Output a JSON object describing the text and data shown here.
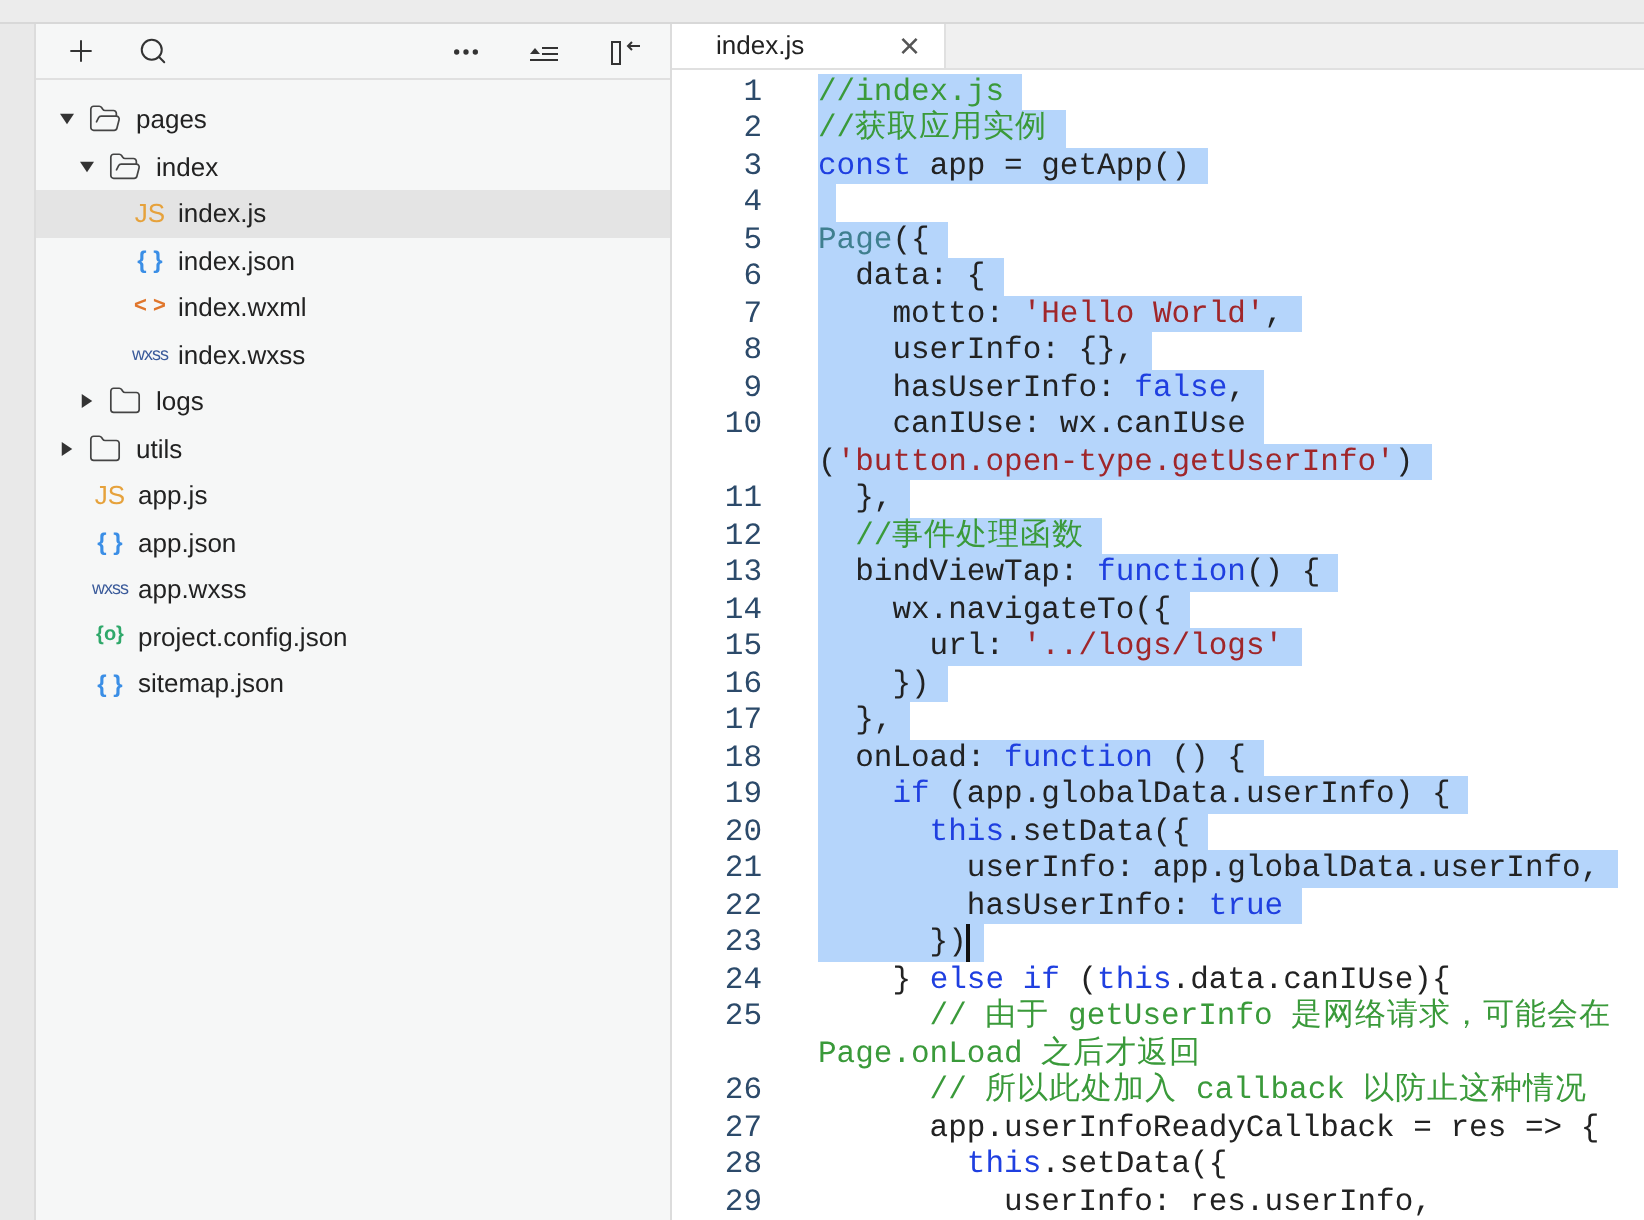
{
  "sidebar": {
    "tree": [
      {
        "name": "pages",
        "kind": "folder",
        "expanded": true,
        "selected": false,
        "children": [
          {
            "name": "index",
            "kind": "folder",
            "expanded": true,
            "selected": false,
            "children": [
              {
                "name": "index.js",
                "kind": "js",
                "icon": "JS",
                "selected": true
              },
              {
                "name": "index.json",
                "kind": "json",
                "icon": "{ }",
                "selected": false
              },
              {
                "name": "index.wxml",
                "kind": "wxml",
                "icon": "< >",
                "selected": false
              },
              {
                "name": "index.wxss",
                "kind": "wxss",
                "icon": "wxss",
                "selected": false
              }
            ]
          },
          {
            "name": "logs",
            "kind": "folder",
            "expanded": false,
            "selected": false
          }
        ]
      },
      {
        "name": "utils",
        "kind": "folder",
        "expanded": false,
        "selected": false
      },
      {
        "name": "app.js",
        "kind": "js",
        "icon": "JS",
        "selected": false
      },
      {
        "name": "app.json",
        "kind": "json",
        "icon": "{ }",
        "selected": false
      },
      {
        "name": "app.wxss",
        "kind": "wxss",
        "icon": "wxss",
        "selected": false
      },
      {
        "name": "project.config.json",
        "kind": "config",
        "icon": "{o}",
        "selected": false
      },
      {
        "name": "sitemap.json",
        "kind": "json",
        "icon": "{ }",
        "selected": false
      }
    ]
  },
  "editor": {
    "tab": {
      "label": "index.js",
      "close": "×"
    },
    "lines": [
      {
        "number": "1",
        "selected": true,
        "caret": false,
        "tokens": [
          {
            "kind": "comment",
            "t": "//index.js"
          }
        ]
      },
      {
        "number": "2",
        "selected": true,
        "caret": false,
        "tokens": [
          {
            "kind": "comment",
            "t": "//获取应用实例"
          }
        ]
      },
      {
        "number": "3",
        "selected": true,
        "caret": false,
        "tokens": [
          {
            "kind": "keyword",
            "t": "const"
          },
          {
            "kind": "plain",
            "t": " app = getApp()"
          }
        ]
      },
      {
        "number": "4",
        "selected": true,
        "caret": false
      },
      {
        "number": "5",
        "selected": true,
        "caret": false,
        "tokens": [
          {
            "kind": "type",
            "t": "Page"
          },
          {
            "kind": "plain",
            "t": "({"
          }
        ]
      },
      {
        "number": "6",
        "selected": true,
        "caret": false,
        "tokens": [
          {
            "kind": "plain",
            "t": "  data: {"
          }
        ]
      },
      {
        "number": "7",
        "selected": true,
        "caret": false,
        "tokens": [
          {
            "kind": "plain",
            "t": "    motto: "
          },
          {
            "kind": "string",
            "t": "'Hello World'"
          },
          {
            "kind": "plain",
            "t": ","
          }
        ]
      },
      {
        "number": "8",
        "selected": true,
        "caret": false,
        "tokens": [
          {
            "kind": "plain",
            "t": "    userInfo: {},"
          }
        ]
      },
      {
        "number": "9",
        "selected": true,
        "caret": false,
        "tokens": [
          {
            "kind": "plain",
            "t": "    hasUserInfo: "
          },
          {
            "kind": "keyword",
            "t": "false"
          },
          {
            "kind": "plain",
            "t": ","
          }
        ]
      },
      {
        "number": "10",
        "selected": true,
        "caret": false,
        "tokens": [
          {
            "kind": "plain",
            "t": "    canIUse: wx.canIUse"
          }
        ]
      },
      {
        "selected": true,
        "caret": false,
        "tokens": [
          {
            "kind": "plain",
            "t": "("
          },
          {
            "kind": "string",
            "t": "'button.open-type.getUserInfo'"
          },
          {
            "kind": "plain",
            "t": ")"
          }
        ]
      },
      {
        "number": "11",
        "selected": true,
        "caret": false,
        "tokens": [
          {
            "kind": "plain",
            "t": "  },"
          }
        ]
      },
      {
        "number": "12",
        "selected": true,
        "caret": false,
        "tokens": [
          {
            "kind": "comment",
            "t": "  //事件处理函数"
          }
        ]
      },
      {
        "number": "13",
        "selected": true,
        "caret": false,
        "tokens": [
          {
            "kind": "plain",
            "t": "  bindViewTap: "
          },
          {
            "kind": "keyword",
            "t": "function"
          },
          {
            "kind": "plain",
            "t": "() {"
          }
        ]
      },
      {
        "number": "14",
        "selected": true,
        "caret": false,
        "tokens": [
          {
            "kind": "plain",
            "t": "    wx.navigateTo({"
          }
        ]
      },
      {
        "number": "15",
        "selected": true,
        "caret": false,
        "tokens": [
          {
            "kind": "plain",
            "t": "      url: "
          },
          {
            "kind": "string",
            "t": "'../logs/logs'"
          }
        ]
      },
      {
        "number": "16",
        "selected": true,
        "caret": false,
        "tokens": [
          {
            "kind": "plain",
            "t": "    })"
          }
        ]
      },
      {
        "number": "17",
        "selected": true,
        "caret": false,
        "tokens": [
          {
            "kind": "plain",
            "t": "  },"
          }
        ]
      },
      {
        "number": "18",
        "selected": true,
        "caret": false,
        "tokens": [
          {
            "kind": "plain",
            "t": "  onLoad: "
          },
          {
            "kind": "keyword",
            "t": "function"
          },
          {
            "kind": "plain",
            "t": " () {"
          }
        ]
      },
      {
        "number": "19",
        "selected": true,
        "caret": false,
        "tokens": [
          {
            "kind": "keyword",
            "t": "    if"
          },
          {
            "kind": "plain",
            "t": " (app.globalData.userInfo) {"
          }
        ]
      },
      {
        "number": "20",
        "selected": true,
        "caret": false,
        "tokens": [
          {
            "kind": "keyword",
            "t": "      this"
          },
          {
            "kind": "plain",
            "t": ".setData({"
          }
        ]
      },
      {
        "number": "21",
        "selected": true,
        "caret": false,
        "tokens": [
          {
            "kind": "plain",
            "t": "        userInfo: app.globalData.userInfo,"
          }
        ]
      },
      {
        "number": "22",
        "selected": true,
        "caret": false,
        "tokens": [
          {
            "kind": "plain",
            "t": "        hasUserInfo: "
          },
          {
            "kind": "keyword",
            "t": "true"
          }
        ]
      },
      {
        "number": "23",
        "selected": true,
        "caret": true,
        "tokens": [
          {
            "kind": "plain",
            "t": "      })"
          }
        ]
      },
      {
        "number": "24",
        "selected": false,
        "caret": false,
        "tokens": [
          {
            "kind": "plain",
            "t": "    } "
          },
          {
            "kind": "keyword",
            "t": "else if"
          },
          {
            "kind": "plain",
            "t": " ("
          },
          {
            "kind": "keyword",
            "t": "this"
          },
          {
            "kind": "plain",
            "t": ".data.canIUse){"
          }
        ]
      },
      {
        "number": "25",
        "selected": false,
        "caret": false,
        "tokens": [
          {
            "kind": "comment",
            "t": "      // 由于 getUserInfo 是网络请求，可能会在"
          }
        ]
      },
      {
        "selected": false,
        "caret": false,
        "tokens": [
          {
            "kind": "comment",
            "t": "Page.onLoad 之后才返回"
          }
        ]
      },
      {
        "number": "26",
        "selected": false,
        "caret": false,
        "tokens": [
          {
            "kind": "comment",
            "t": "      // 所以此处加入 callback 以防止这种情况"
          }
        ]
      },
      {
        "number": "27",
        "selected": false,
        "caret": false,
        "tokens": [
          {
            "kind": "plain",
            "t": "      app.userInfoReadyCallback = res => {"
          }
        ]
      },
      {
        "number": "28",
        "selected": false,
        "caret": false,
        "tokens": [
          {
            "kind": "keyword",
            "t": "        this"
          },
          {
            "kind": "plain",
            "t": ".setData({"
          }
        ]
      },
      {
        "number": "29",
        "selected": false,
        "caret": false,
        "tokens": [
          {
            "kind": "plain",
            "t": "          userInfo: res.userInfo,"
          }
        ]
      }
    ]
  }
}
